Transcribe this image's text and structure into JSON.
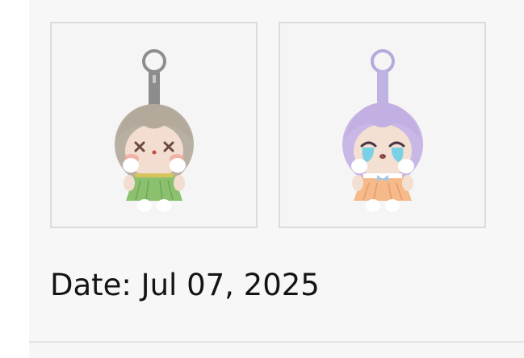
{
  "product_images": [
    {
      "name": "green-dress-figure",
      "dress_color": "#8bc06f",
      "hair_color": "#b7afa2",
      "ring_color": "#8e8e8e"
    },
    {
      "name": "lavender-hair-figure",
      "dress_color": "#f5b98a",
      "hair_color": "#c9b7e6",
      "ring_color": "#b8a9dc"
    }
  ],
  "date": {
    "label": "Date:",
    "value": "Jul 07, 2025"
  }
}
